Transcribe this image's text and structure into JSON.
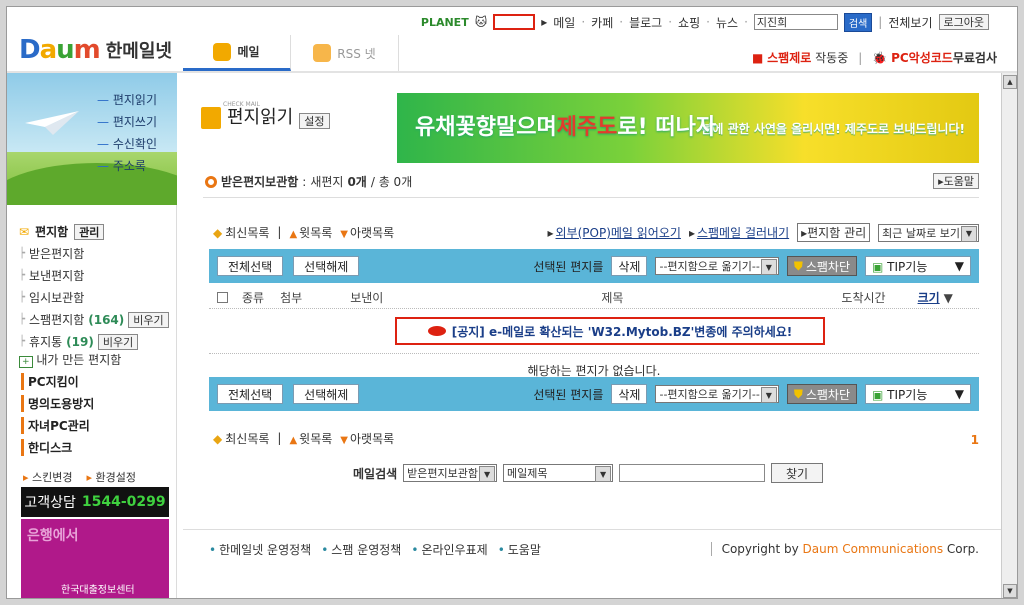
{
  "top": {
    "planet": "PLANET",
    "links": [
      "메일",
      "카페",
      "블로그",
      "쇼핑",
      "뉴스"
    ],
    "search_value": "지진희",
    "search_button": "검색",
    "view_all": "전체보기",
    "logout": "로그아웃"
  },
  "logo": {
    "title": "한메일넷"
  },
  "tabs": [
    {
      "label": "메일"
    },
    {
      "label": "RSS 넷"
    }
  ],
  "status_right": {
    "spam_label": "스팸제로",
    "spam_state": "작동중",
    "pc_check": "PC악성코드",
    "pc_check_suffix": "무료검사"
  },
  "sidebar": {
    "hero_links": [
      "편지읽기",
      "편지쓰기",
      "수신확인",
      "주소록"
    ],
    "mailbox_title": "편지함",
    "manage": "관리",
    "folders": [
      {
        "label": "받은편지함"
      },
      {
        "label": "보낸편지함"
      },
      {
        "label": "임시보관함"
      },
      {
        "label": "스팸편지함",
        "count": "(164)",
        "action": "비우기"
      },
      {
        "label": "휴지통",
        "count": "(19)",
        "action": "비우기"
      }
    ],
    "my_folders": "내가 만든 편지함",
    "bold_links": [
      "PC지킴이",
      "명의도용방지",
      "자녀PC관리",
      "한디스크"
    ],
    "skin": "스킨변경",
    "settings": "환경설정",
    "cs_label": "고객상담",
    "cs_number": "1544-0299",
    "ad_text": "은행에서",
    "ad_sub": "한국대출정보센터"
  },
  "main": {
    "check_mail": "CHECK MAIL",
    "title": "편지읽기",
    "settings_btn": "설정",
    "banner_big": "유채꽃향말으며",
    "banner_big_red": "제주도",
    "banner_big_tail": "로! 떠나자",
    "banner_text": "봄에 관한 사연을 올리시면! 제주도로 보내드립니다!",
    "box_status_label": "받은편지보관함",
    "box_status_new": "새편지",
    "box_status_new_count": "0개",
    "box_status_total": "/ 총 0개",
    "help": "도움말",
    "nav": {
      "latest": "최신목록",
      "prev": "윗목록",
      "next": "아랫목록"
    },
    "pop": {
      "pop_mail": "외부(POP)메일 읽어오기",
      "spam_filter": "스팸메일 걸러내기",
      "box_manage": "편지함 관리",
      "sort": "최근 날짜로 보기"
    },
    "toolbar": {
      "select_all": "전체선택",
      "deselect": "선택해제",
      "selected_label": "선택된 편지를",
      "delete": "삭제",
      "move_select": "--편지함으로 옮기기--",
      "spam_block": "스팸차단",
      "tip": "TIP기능"
    },
    "columns": [
      "종류",
      "첨부",
      "보낸이",
      "제목",
      "도착시간"
    ],
    "size_link": "크기",
    "notice": "[공지] e-메일로 확산되는 'W32.Mytob.BZ'변종에 주의하세요!",
    "empty": "해당하는 편지가 없습니다.",
    "page": "1",
    "search": {
      "label": "메일검색",
      "box": "받은편지보관함",
      "field": "메일제목",
      "button": "찾기"
    },
    "footer_links": [
      "한메일넷 운영정책",
      "스팸 운영정책",
      "온라인우표제",
      "도움말"
    ],
    "copyright_prefix": "Copyright by ",
    "copyright_org": "Daum Communications",
    "copyright_suffix": " Corp."
  }
}
